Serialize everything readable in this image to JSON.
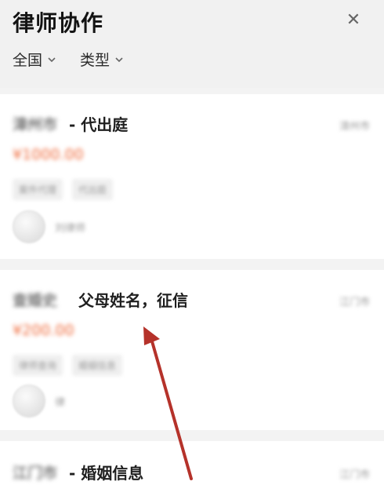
{
  "header": {
    "title": "律师协作",
    "close_icon": "close-icon"
  },
  "filters": [
    {
      "label": "全国",
      "icon": "chevron-down-icon"
    },
    {
      "label": "类型",
      "icon": "chevron-down-icon"
    }
  ],
  "cards": [
    {
      "location": "漳州市",
      "title": "- 代出庭",
      "date": "漳州市",
      "price": "¥1000.00",
      "tags": [
        "案件代理",
        "代出庭"
      ],
      "lawyer": "刘律师"
    },
    {
      "location": "查婚史",
      "title": "父母姓名，征信",
      "date": "江门市",
      "price": "¥200.00",
      "tags": [
        "律师查询",
        "婚姻信息"
      ],
      "lawyer": "律"
    },
    {
      "location": "江门市",
      "title": "- 婚姻信息",
      "date": "江门市"
    }
  ],
  "colors": {
    "accent_price": "#ef6a3b",
    "arrow": "#b5322a"
  }
}
